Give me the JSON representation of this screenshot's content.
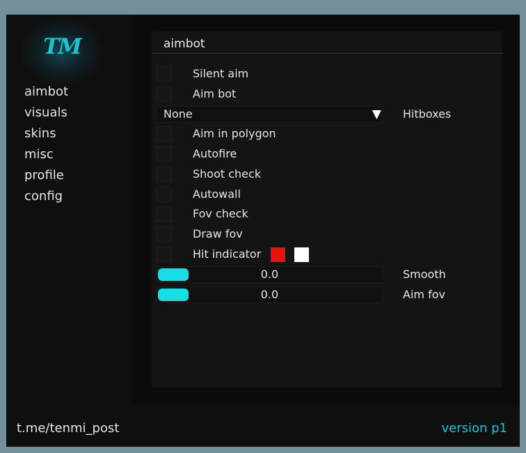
{
  "brand": {
    "logo_text": "TM",
    "accent_color": "#17c6d2"
  },
  "sidebar": {
    "items": [
      {
        "label": "aimbot"
      },
      {
        "label": "visuals"
      },
      {
        "label": "skins"
      },
      {
        "label": "misc"
      },
      {
        "label": "profile"
      },
      {
        "label": "config"
      }
    ]
  },
  "panel": {
    "title": "aimbot",
    "checkboxes": {
      "silent_aim": {
        "label": "Silent aim",
        "checked": false
      },
      "aim_bot": {
        "label": "Aim bot",
        "checked": false
      },
      "aim_in_polygon": {
        "label": "Aim in polygon",
        "checked": false
      },
      "autofire": {
        "label": "Autofire",
        "checked": false
      },
      "shoot_check": {
        "label": "Shoot check",
        "checked": false
      },
      "autowall": {
        "label": "Autowall",
        "checked": false
      },
      "fov_check": {
        "label": "Fov check",
        "checked": false
      },
      "draw_fov": {
        "label": "Draw fov",
        "checked": false
      },
      "hit_indicator": {
        "label": "Hit indicator",
        "checked": false
      }
    },
    "hitboxes": {
      "label": "Hitboxes",
      "selected": "None",
      "arrow": "▼"
    },
    "hit_indicator_colors": [
      "#e8120c",
      "#ffffff"
    ],
    "sliders": {
      "smooth": {
        "label": "Smooth",
        "value": "0.0"
      },
      "aim_fov": {
        "label": "Aim fov",
        "value": "0.0"
      }
    },
    "slider_color": "#17dde6"
  },
  "footer": {
    "link": "t.me/tenmi_post",
    "version": "version p1",
    "version_color": "#17c6d2"
  }
}
